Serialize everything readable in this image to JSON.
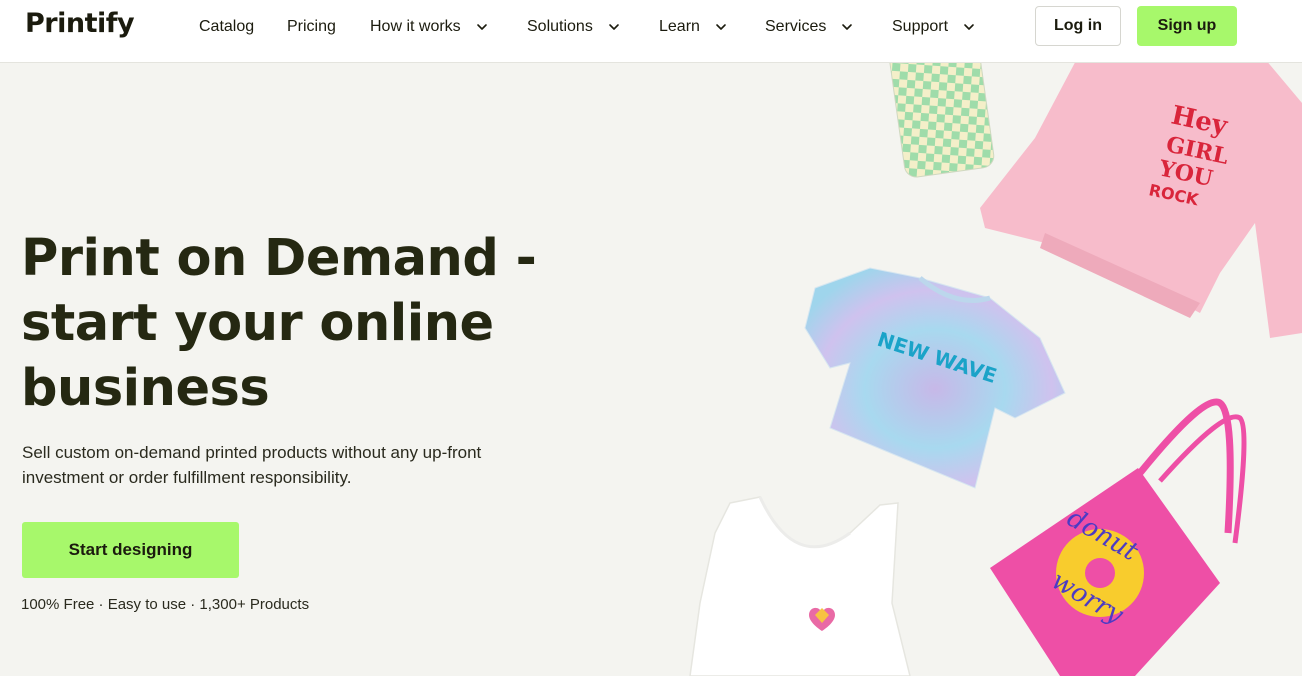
{
  "header": {
    "logo_text": "Printify",
    "nav": [
      {
        "label": "Catalog",
        "has_dropdown": false
      },
      {
        "label": "Pricing",
        "has_dropdown": false
      },
      {
        "label": "How it works",
        "has_dropdown": true
      },
      {
        "label": "Solutions",
        "has_dropdown": true
      },
      {
        "label": "Learn",
        "has_dropdown": true
      },
      {
        "label": "Services",
        "has_dropdown": true
      },
      {
        "label": "Support",
        "has_dropdown": true
      }
    ],
    "login_label": "Log in",
    "signup_label": "Sign up"
  },
  "hero": {
    "title": "Print on Demand - start your online business",
    "title_lines": [
      "Print on Demand -",
      "start your online",
      "business"
    ],
    "subtitle_lines": [
      "Sell custom on-demand printed products without any up-front",
      "investment or order fulfillment responsibility."
    ],
    "cta_label": "Start designing",
    "features": "100% Free · Easy to use · 1,300+ Products"
  },
  "products": {
    "sweatshirt_print": [
      "Hey",
      "GIRL",
      "YOU",
      "ROCK"
    ],
    "tshirt_print": "NEW WAVE",
    "tote_print": [
      "donut",
      "worry"
    ]
  },
  "colors": {
    "accent": "#a7f86b",
    "background": "#f4f4f0",
    "text": "#252812"
  }
}
